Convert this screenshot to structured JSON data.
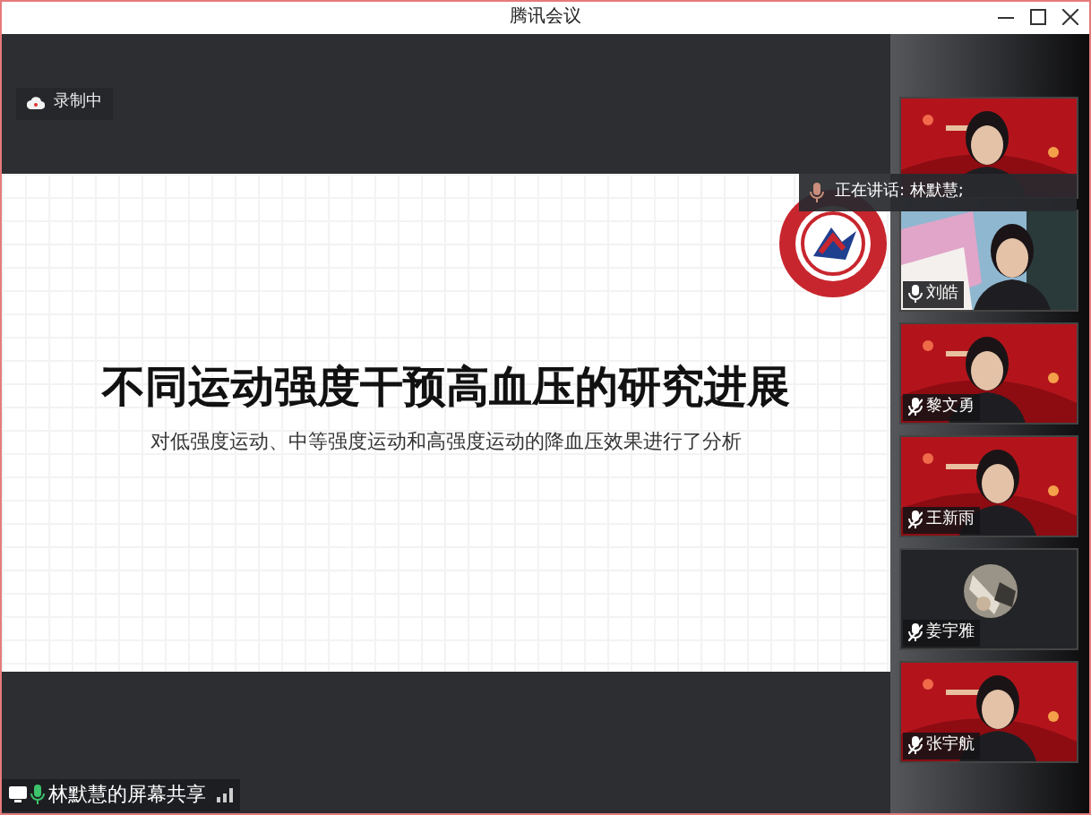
{
  "window": {
    "title": "腾讯会议"
  },
  "recording": {
    "label": "录制中"
  },
  "slide": {
    "title": "不同运动强度干预高血压的研究进展",
    "subtitle": "对低强度运动、中等强度运动和高强度运动的降血压效果进行了分析"
  },
  "speaking": {
    "label": "正在讲话: 林默慧;"
  },
  "participants": [
    {
      "kind": "video"
    },
    {
      "kind": "video",
      "name": "刘皓",
      "muted": false
    },
    {
      "kind": "video",
      "name": "黎文勇",
      "muted": true
    },
    {
      "kind": "video",
      "name": "王新雨",
      "muted": true
    },
    {
      "kind": "avatar",
      "name": "姜宇雅",
      "muted": true
    },
    {
      "kind": "video",
      "name": "张宇航",
      "muted": true
    }
  ],
  "share_status": {
    "label": "林默慧的屏幕共享"
  }
}
